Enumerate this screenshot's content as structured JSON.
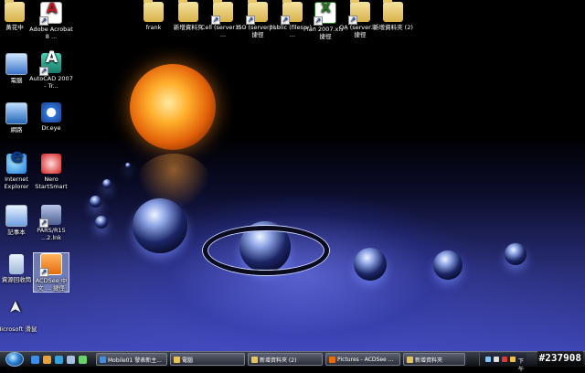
{
  "desktop_icons": {
    "left_column": [
      {
        "label": "黃花中",
        "icon": "folder-icon"
      },
      {
        "label": "電腦",
        "icon": "computer-icon"
      },
      {
        "label": "網路",
        "icon": "network-icon"
      },
      {
        "label": "Internet Explorer",
        "icon": "internet-explorer-icon"
      },
      {
        "label": "記事本",
        "icon": "notepad-icon"
      },
      {
        "label": "資源回收筒",
        "icon": "recycle-bin-icon"
      },
      {
        "label": "Microsoft 滑鼠",
        "icon": "mouse-pointer-icon"
      }
    ],
    "second_column": [
      {
        "label": "Adobe Acrobat 8 ...",
        "icon": "adobe-acrobat-icon"
      },
      {
        "label": "AutoCAD 2007 - Tr...",
        "icon": "autocad-icon"
      },
      {
        "label": "Dr.eye",
        "icon": "dreye-icon"
      },
      {
        "label": "Nero StartSmart",
        "icon": "nero-icon"
      },
      {
        "label": "PARS/R15 ...2.lnk",
        "icon": "pars-icon"
      },
      {
        "label": "ACDSee 中文 ... 捷徑",
        "icon": "acdsee-icon"
      }
    ],
    "top_row": [
      {
        "label": "frank",
        "icon": "folder-icon"
      },
      {
        "label": "新增資料夾",
        "icon": "folder-icon"
      },
      {
        "label": "Cell (server3) - ...",
        "icon": "network-folder-icon"
      },
      {
        "label": "ISO (server3) - 捷徑",
        "icon": "network-folder-icon"
      },
      {
        "label": "public (filesrv) - ...",
        "icon": "network-folder-icon"
      },
      {
        "label": "Plan 2007.xls - 捷徑",
        "icon": "excel-file-icon"
      },
      {
        "label": "QA (server3) - 捷徑",
        "icon": "network-folder-icon"
      },
      {
        "label": "新增資料夾 (2)",
        "icon": "folder-icon"
      }
    ]
  },
  "taskbar": {
    "start_icon": "windows-start-orb-icon",
    "quick_launch": [
      "ie-icon",
      "folder-icon",
      "media-icon",
      "desktop-icon",
      "app-icon"
    ],
    "buttons": [
      {
        "label": "Mobile01 發表新主...",
        "icon": "ie-icon",
        "color": "#3c8ee6"
      },
      {
        "label": "電腦",
        "icon": "folder-icon",
        "color": "#e8c35a"
      },
      {
        "label": "新增資料夾 (2)",
        "icon": "folder-icon",
        "color": "#e8c35a"
      },
      {
        "label": "Pictures - ACDSee ...",
        "icon": "acdsee-icon",
        "color": "#e86b0a"
      },
      {
        "label": "新增資料夾",
        "icon": "folder-icon",
        "color": "#e8c35a"
      }
    ],
    "tray_icons": [
      "network-tray-icon",
      "volume-tray-icon",
      "security-tray-icon",
      "update-tray-icon"
    ],
    "clock": "下午"
  },
  "watermark_id": "#237908"
}
